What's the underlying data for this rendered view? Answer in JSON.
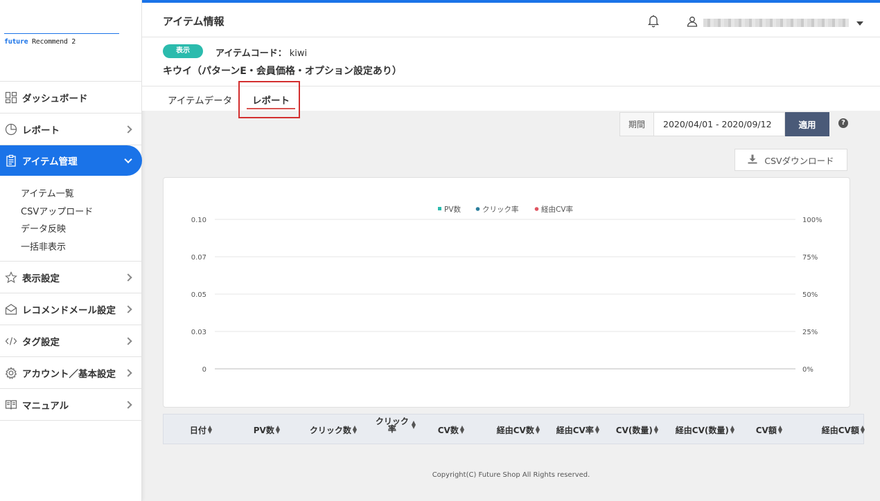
{
  "logo": {
    "accent": "future",
    "rest": " Recommend 2"
  },
  "sidebar": {
    "items": [
      {
        "label": "ダッシュボード",
        "icon": "dashboard-icon"
      },
      {
        "label": "レポート",
        "icon": "pie-chart-icon"
      },
      {
        "label": "アイテム管理",
        "icon": "clipboard-icon",
        "active": true
      },
      {
        "label": "表示設定",
        "icon": "star-icon"
      },
      {
        "label": "レコメンドメール設定",
        "icon": "mail-icon"
      },
      {
        "label": "タグ設定",
        "icon": "code-icon"
      },
      {
        "label": "アカウント／基本設定",
        "icon": "gear-icon"
      },
      {
        "label": "マニュアル",
        "icon": "book-icon"
      }
    ],
    "subitems": [
      "アイテム一覧",
      "CSVアップロード",
      "データ反映",
      "一括非表示"
    ]
  },
  "header": {
    "title": "アイテム情報"
  },
  "item": {
    "status_badge": "表示",
    "code_label": "アイテムコード：",
    "code_value": "kiwi",
    "name": "キウイ（パターンE・会員価格・オプション設定あり）"
  },
  "tabs": [
    "アイテムデータ",
    "レポート"
  ],
  "period": {
    "label": "期間",
    "value": "2020/04/01 - 2020/09/12",
    "apply": "適用"
  },
  "csv_button": "CSVダウンロード",
  "chart_data": {
    "type": "line",
    "legend": [
      {
        "name": "PV数",
        "color": "#2bbbad",
        "shape": "square"
      },
      {
        "name": "クリック率",
        "color": "#2a7d9c",
        "shape": "circle"
      },
      {
        "name": "経由CV率",
        "color": "#e05561",
        "shape": "circle"
      }
    ],
    "legend_position": "top-center",
    "y_left_ticks": [
      "0.10",
      "0.07",
      "0.05",
      "0.03",
      "0"
    ],
    "y_right_ticks": [
      "100%",
      "75%",
      "50%",
      "25%",
      "0%"
    ],
    "y_left_range": [
      0,
      0.1
    ],
    "y_right_range": [
      0,
      100
    ],
    "grid": true,
    "series": []
  },
  "table": {
    "headers": [
      "日付",
      "PV数",
      "クリック数",
      "クリック率",
      "CV数",
      "経由CV数",
      "経由CV率",
      "CV(数量)",
      "経由CV(数量)",
      "CV額",
      "経由CV額"
    ]
  },
  "footer": "Copyright(C) Future Shop All Rights reserved."
}
